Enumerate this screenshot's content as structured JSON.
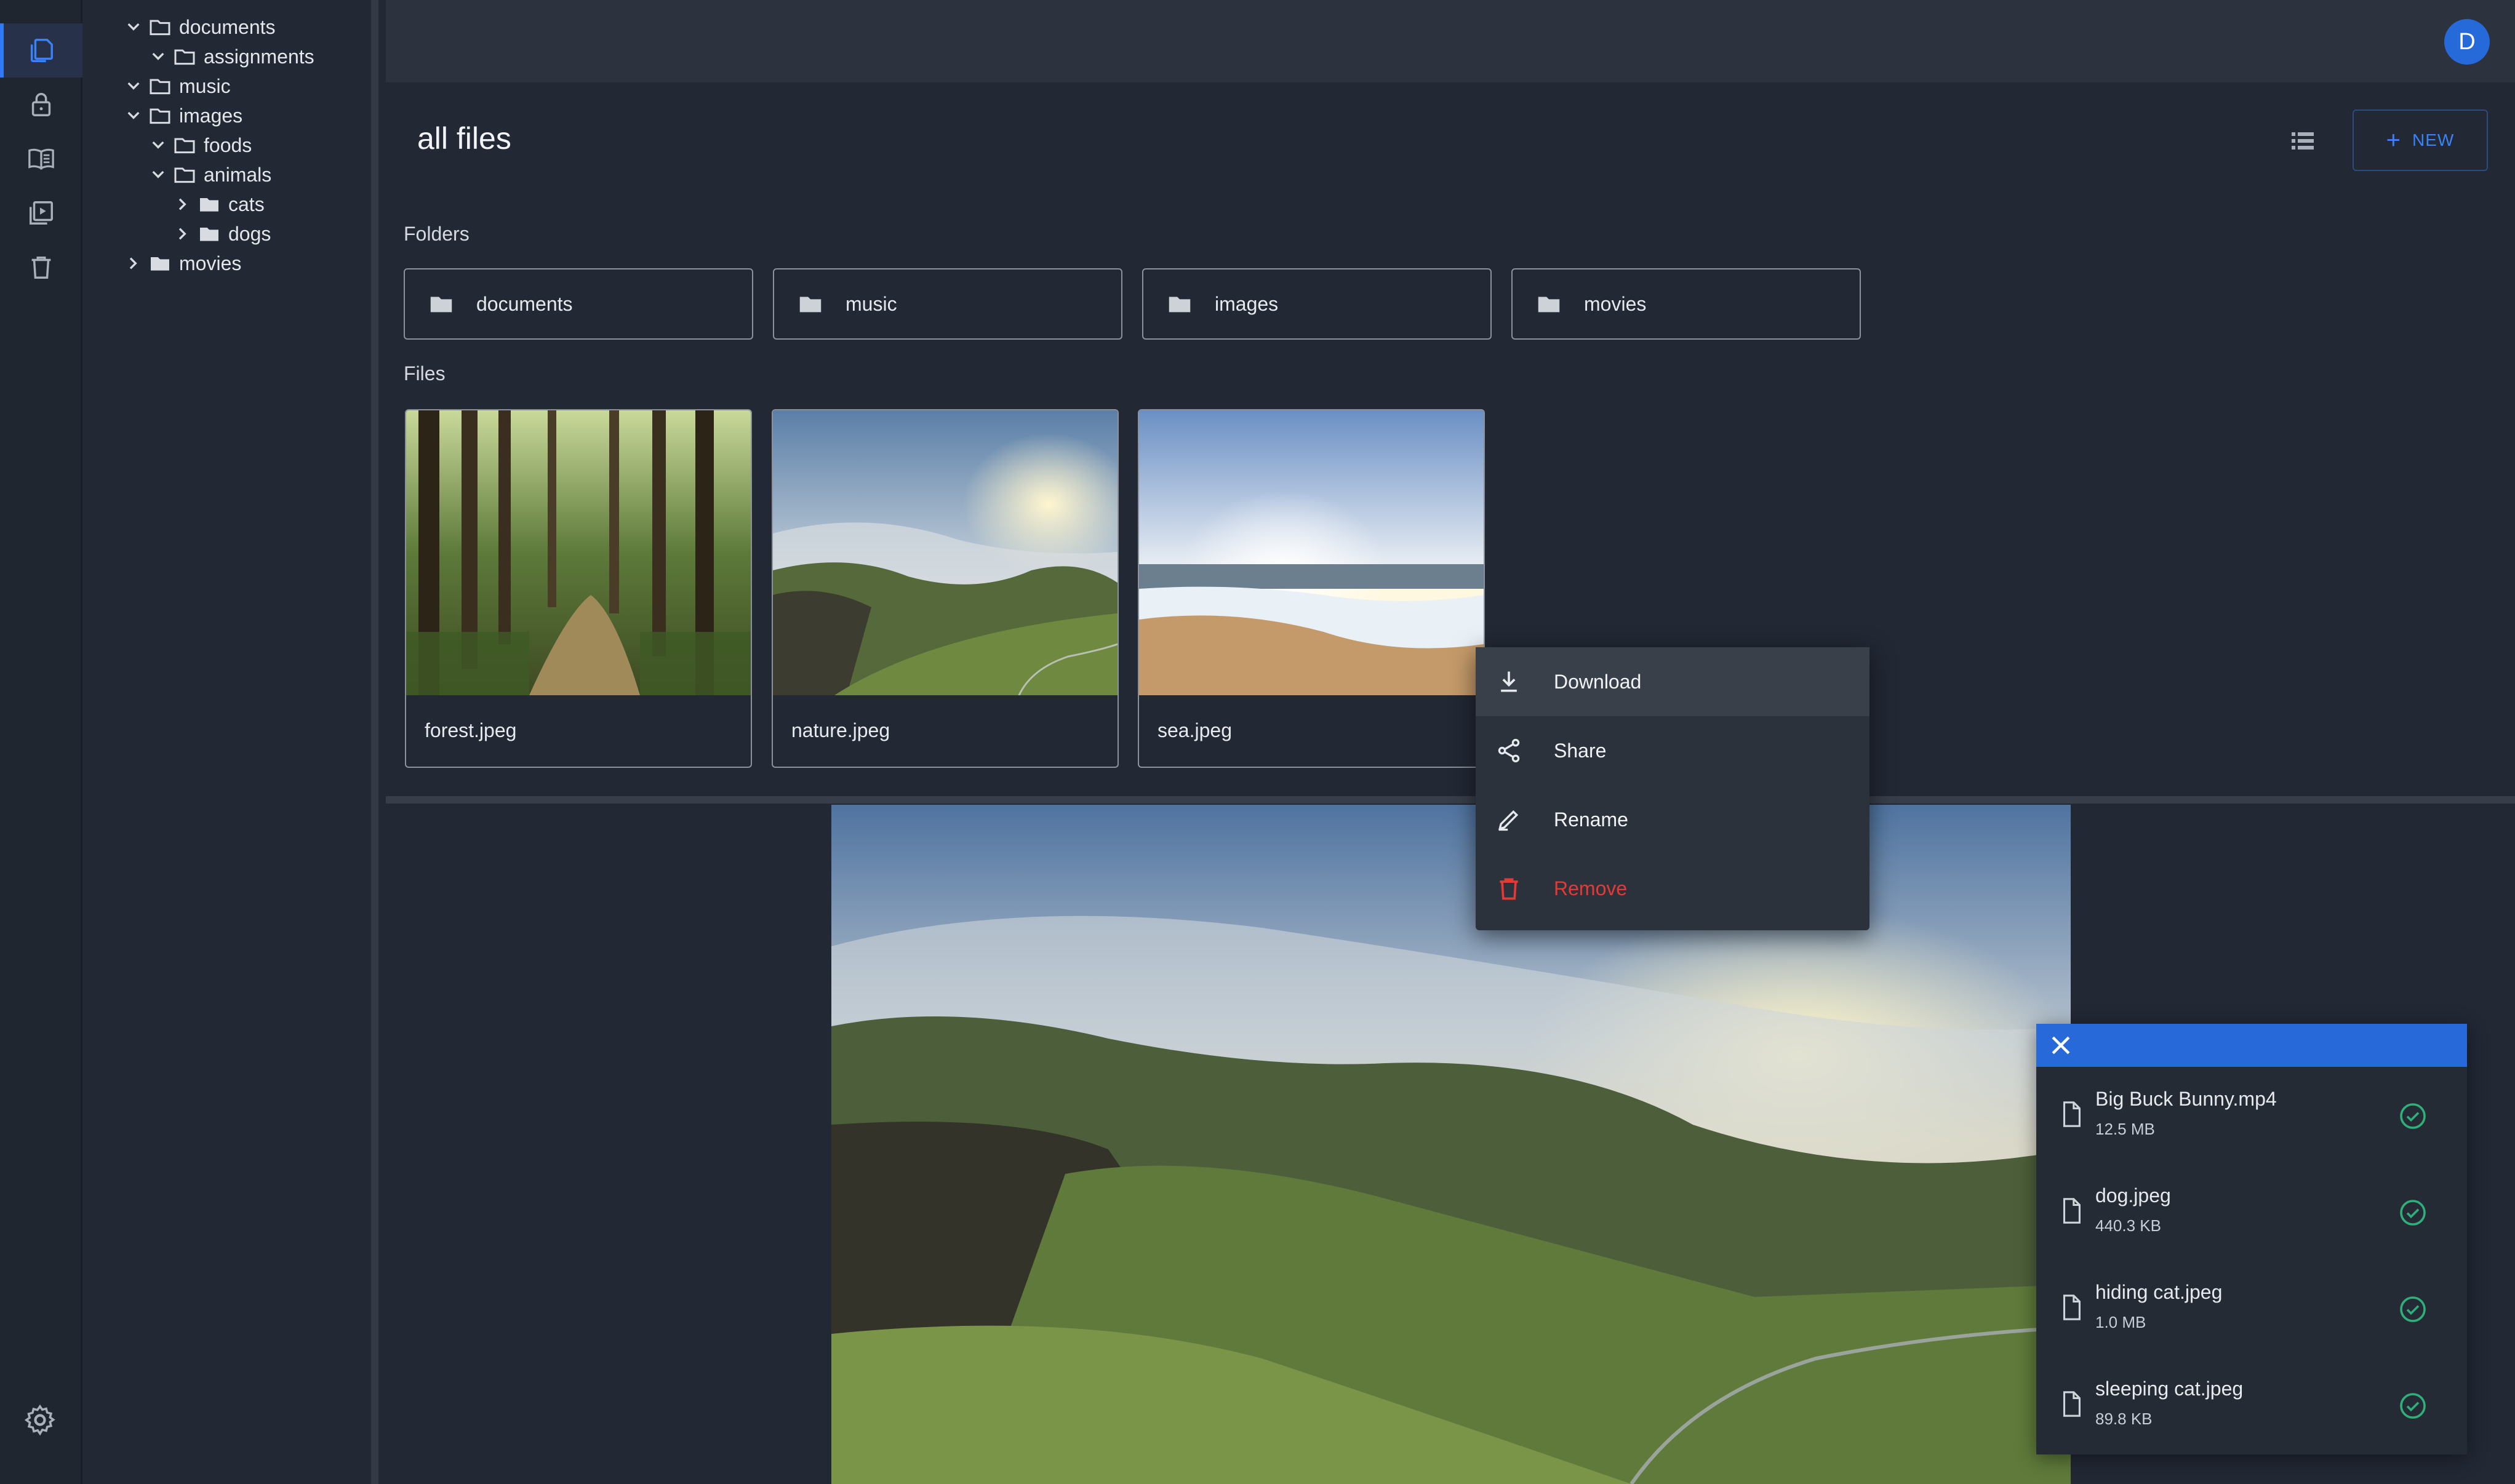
{
  "header": {
    "avatar_initial": "D"
  },
  "rail": {
    "items": [
      {
        "icon": "files-icon",
        "active": true
      },
      {
        "icon": "lock-icon"
      },
      {
        "icon": "book-icon"
      },
      {
        "icon": "video-library-icon"
      },
      {
        "icon": "trash-icon"
      }
    ],
    "settings_icon": "gear-icon"
  },
  "tree": {
    "documents": "documents",
    "assignments": "assignments",
    "music": "music",
    "images": "images",
    "foods": "foods",
    "animals": "animals",
    "cats": "cats",
    "dogs": "dogs",
    "movies": "movies"
  },
  "main": {
    "title": "all files",
    "new_label": "NEW",
    "folders_label": "Folders",
    "files_label": "Files",
    "folders": [
      "documents",
      "music",
      "images",
      "movies"
    ],
    "files": [
      "forest.jpeg",
      "nature.jpeg",
      "sea.jpeg"
    ]
  },
  "context_menu": {
    "download": "Download",
    "share": "Share",
    "rename": "Rename",
    "remove": "Remove"
  },
  "uploads": [
    {
      "name": "Big Buck Bunny.mp4",
      "size": "12.5 MB"
    },
    {
      "name": "dog.jpeg",
      "size": "440.3 KB"
    },
    {
      "name": "hiding cat.jpeg",
      "size": "1.0 MB"
    },
    {
      "name": "sleeping cat.jpeg",
      "size": "89.8 KB"
    }
  ],
  "colors": {
    "accent": "#2669d9",
    "danger": "#e53935",
    "success": "#2fb07a",
    "background": "#222834"
  }
}
